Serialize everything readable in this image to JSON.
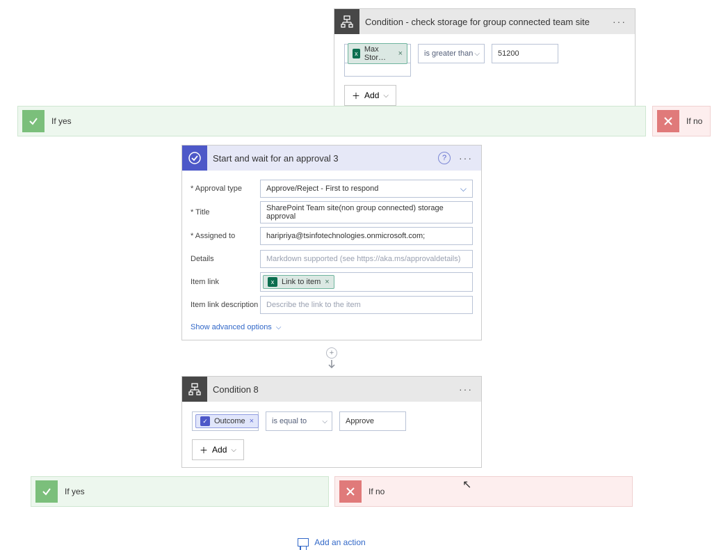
{
  "condition1": {
    "title": "Condition - check storage for group connected team site",
    "token": "Max Stor…",
    "operator": "is greater than",
    "value": "51200",
    "add_label": "Add"
  },
  "branches": {
    "if_yes": "If yes",
    "if_no": "If no"
  },
  "approval": {
    "title": "Start and wait for an approval 3",
    "fields": {
      "approval_type_label": "* Approval type",
      "approval_type_value": "Approve/Reject - First to respond",
      "title_label": "* Title",
      "title_value": "SharePoint Team site(non group connected) storage approval",
      "assigned_to_label": "* Assigned to",
      "assigned_to_value": "haripriya@tsinfotechnologies.onmicrosoft.com;",
      "details_label": "Details",
      "details_placeholder": "Markdown supported (see https://aka.ms/approvaldetails)",
      "item_link_label": "Item link",
      "item_link_token": "Link to item",
      "item_link_desc_label": "Item link description",
      "item_link_desc_placeholder": "Describe the link to the item"
    },
    "advanced": "Show advanced options"
  },
  "condition2": {
    "title": "Condition 8",
    "token": "Outcome",
    "operator": "is equal to",
    "value": "Approve",
    "add_label": "Add"
  },
  "footer": {
    "add_action": "Add an action"
  }
}
